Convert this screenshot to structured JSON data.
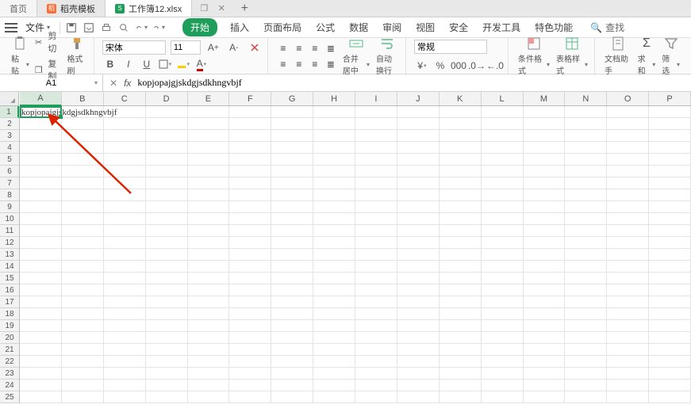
{
  "tabs": {
    "home": "首页",
    "template_icon": "稻",
    "template": "稻壳模板",
    "doc_icon": "S",
    "doc": "工作簿12.xlsx"
  },
  "file_menu": "文件",
  "ribbon_tabs": {
    "start": "开始",
    "insert": "插入",
    "layout": "页面布局",
    "formula": "公式",
    "data": "数据",
    "review": "审阅",
    "view": "视图",
    "security": "安全",
    "dev": "开发工具",
    "special": "特色功能",
    "search_icon": "🔍",
    "search": "查找"
  },
  "ribbon": {
    "paste": "粘贴",
    "cut": "剪切",
    "copy": "复制",
    "format_painter": "格式刷",
    "font_name": "宋体",
    "font_size": "11",
    "merge": "合并居中",
    "wrap": "自动换行",
    "number_format": "常规",
    "cond_format": "条件格式",
    "table_style": "表格样式",
    "doc_helper": "文档助手",
    "sum": "求和",
    "filter": "筛选"
  },
  "namebox": "A1",
  "formula": "kopjopajgjskdgjsdkhngvbjf",
  "columns": [
    "A",
    "B",
    "C",
    "D",
    "E",
    "F",
    "G",
    "H",
    "I",
    "J",
    "K",
    "L",
    "M",
    "N",
    "O",
    "P"
  ],
  "rows": [
    "1",
    "2",
    "3",
    "4",
    "5",
    "6",
    "7",
    "8",
    "9",
    "10",
    "11",
    "12",
    "13",
    "14",
    "15",
    "16",
    "17",
    "18",
    "19",
    "20",
    "21",
    "22",
    "23",
    "24",
    "25"
  ],
  "cell_a1": "kopjopajgjskdgjsdkhngvbjf"
}
